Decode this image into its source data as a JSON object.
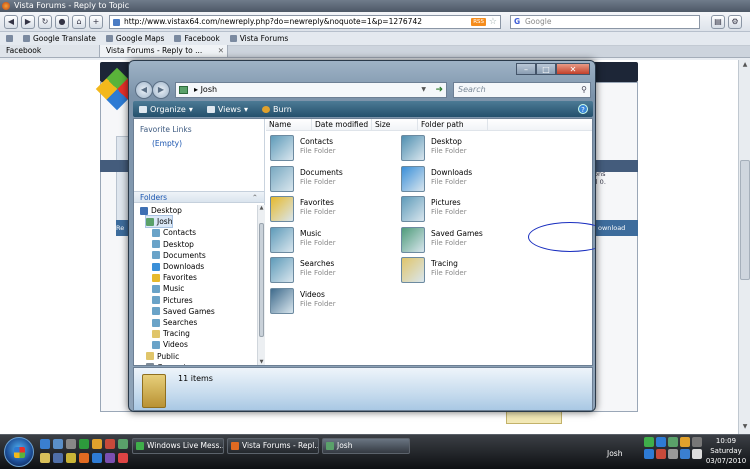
{
  "browser": {
    "title": "Vista Forums - Reply to Topic",
    "url": "http://www.vistax64.com/newreply.php?do=newreply&noquote=1&p=1276742",
    "rss_badge": "RSS",
    "search_placeholder": "Google",
    "search_logo": "G",
    "bookmarks": [
      "Google Translate",
      "Google Maps",
      "Facebook",
      "Vista Forums"
    ],
    "tabs": [
      "Facebook",
      "Vista Forums - Reply to ..."
    ],
    "page_text_right": [
      "ons",
      "ll 0."
    ],
    "page_blue_right": "ownload",
    "page_blue_left": "Re"
  },
  "explorer": {
    "address": "Josh",
    "search_placeholder": "Search",
    "toolbar": {
      "organize": "Organize",
      "views": "Views",
      "burn": "Burn",
      "help": "?"
    },
    "favorite_links_label": "Favorite Links",
    "favorite_links_empty": "(Empty)",
    "folders_label": "Folders",
    "tree": [
      {
        "label": "Desktop",
        "indent": 1,
        "color": "#3d6fb3"
      },
      {
        "label": "Josh",
        "indent": 2,
        "color": "#5aa16a",
        "selected": true
      },
      {
        "label": "Contacts",
        "indent": 3,
        "color": "#6aa3c8"
      },
      {
        "label": "Desktop",
        "indent": 3,
        "color": "#6aa3c8"
      },
      {
        "label": "Documents",
        "indent": 3,
        "color": "#6aa3c8"
      },
      {
        "label": "Downloads",
        "indent": 3,
        "color": "#3a8fd8"
      },
      {
        "label": "Favorites",
        "indent": 3,
        "color": "#e7b92c"
      },
      {
        "label": "Music",
        "indent": 3,
        "color": "#6aa3c8"
      },
      {
        "label": "Pictures",
        "indent": 3,
        "color": "#6aa3c8"
      },
      {
        "label": "Saved Games",
        "indent": 3,
        "color": "#6aa3c8"
      },
      {
        "label": "Searches",
        "indent": 3,
        "color": "#6aa3c8"
      },
      {
        "label": "Tracing",
        "indent": 3,
        "color": "#e0c56a"
      },
      {
        "label": "Videos",
        "indent": 3,
        "color": "#6aa3c8"
      },
      {
        "label": "Public",
        "indent": 2,
        "color": "#e0c56a"
      },
      {
        "label": "Computer",
        "indent": 2,
        "color": "#7f8b97"
      }
    ],
    "columns": [
      "Name",
      "Date modified",
      "Size",
      "Folder path"
    ],
    "items": [
      {
        "name": "Contacts",
        "type": "File Folder",
        "color": "#5e9bb9"
      },
      {
        "name": "Desktop",
        "type": "File Folder",
        "color": "#4f8fb0"
      },
      {
        "name": "Documents",
        "type": "File Folder",
        "color": "#79a9c1"
      },
      {
        "name": "Downloads",
        "type": "File Folder",
        "color": "#3a8fd8"
      },
      {
        "name": "Favorites",
        "type": "File Folder",
        "color": "#e7b92c"
      },
      {
        "name": "Pictures",
        "type": "File Folder",
        "color": "#5e9bb9"
      },
      {
        "name": "Music",
        "type": "File Folder",
        "color": "#5e9bb9"
      },
      {
        "name": "Saved Games",
        "type": "File Folder",
        "color": "#4f9c7a"
      },
      {
        "name": "Searches",
        "type": "File Folder",
        "color": "#5e9bb9"
      },
      {
        "name": "Tracing",
        "type": "File Folder",
        "color": "#e0c56a"
      },
      {
        "name": "Videos",
        "type": "File Folder",
        "color": "#3f6b8c"
      }
    ],
    "item_count": "11 items"
  },
  "taskbar": {
    "tasks": [
      "Windows Live Mess...",
      "Vista Forums - Repl...",
      "Josh"
    ],
    "user": "Josh",
    "time": "10:09",
    "day": "Saturday",
    "date": "03/07/2010"
  }
}
